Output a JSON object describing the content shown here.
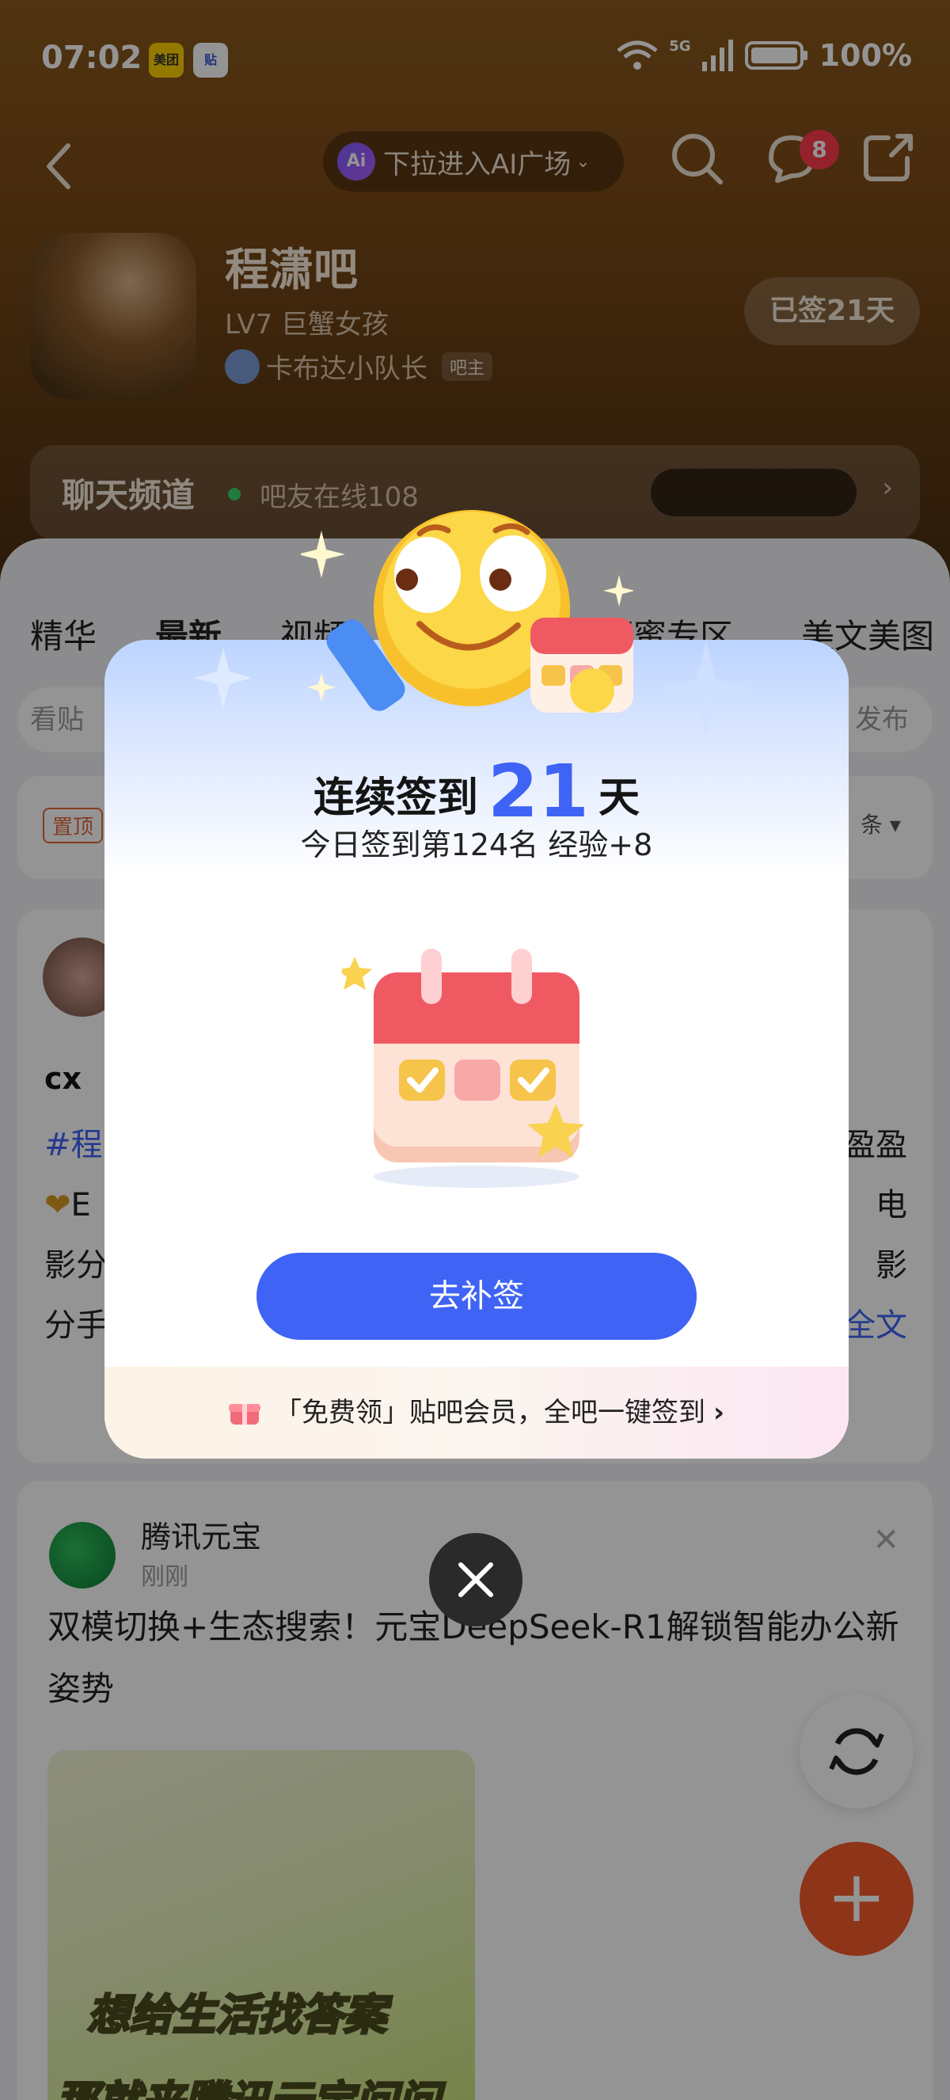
{
  "status_bar": {
    "time": "07:02",
    "badge1": "美团",
    "badge2": "贴",
    "network": "5G",
    "battery": "100%"
  },
  "nav": {
    "ai_pill_label": "下拉进入AI广场",
    "ai_logo": "Ai",
    "message_count": "8"
  },
  "forum": {
    "name": "程潇吧",
    "level": "LV7 巨蟹女孩",
    "owner": "卡布达小队长",
    "owner_tag": "吧主",
    "signed_label": "已签21天"
  },
  "chat_channel": {
    "title": "聊天频道",
    "online": "吧友在线108"
  },
  "tabs": {
    "t1": "精华",
    "t2": "最新",
    "t3": "视频",
    "t4": "蕾蜜专区",
    "t5": "美文美图"
  },
  "search_hint": {
    "left": "看贴",
    "right": "发布"
  },
  "pinned": {
    "tag": "置顶",
    "sort": "条"
  },
  "post1": {
    "user": "cx",
    "line1_hash": "#程",
    "line1_end": "盈盈",
    "line2_start": "E",
    "line2_end": "电",
    "line3_start": "影分",
    "line3_end": "影",
    "line4_start": "分手",
    "line4_more": "全文"
  },
  "post2": {
    "name": "腾讯元宝",
    "time": "刚刚",
    "text": "双模切换+生态搜索！元宝DeepSeek-R1解锁智能办公新姿势",
    "image_line1": "想给生活找答案",
    "image_line2": "那就来腾讯元宝问问吧"
  },
  "modal": {
    "title_prefix": "连续签到",
    "days": "21",
    "title_suffix": "天",
    "subtitle": "今日签到第124名 经验+8",
    "button": "去补签",
    "footer": "「免费领」贴吧会员，全吧一键签到"
  },
  "colors": {
    "accent": "#3e63f5",
    "header_brown": "#7a4a16",
    "badge_red": "#ff3b4f",
    "fab_orange": "#f35a2c"
  }
}
